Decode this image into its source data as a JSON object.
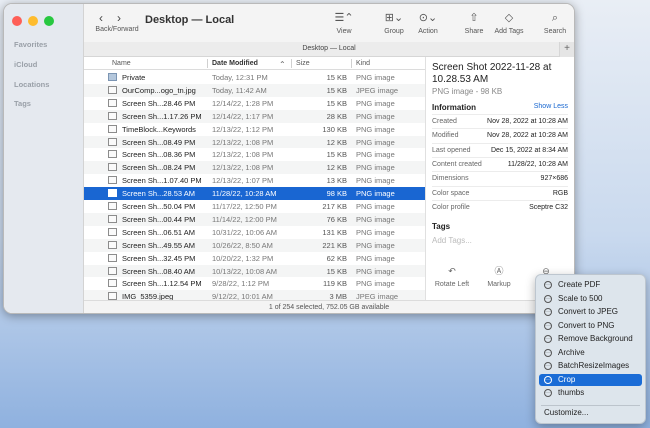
{
  "sidebar": {
    "sections": [
      "Favorites",
      "iCloud",
      "Locations",
      "Tags"
    ]
  },
  "toolbar": {
    "nav_label": "Back/Forward",
    "title": "Desktop — Local",
    "buttons": [
      {
        "name": "view",
        "label": "View",
        "icon": "list-icon"
      },
      {
        "name": "group",
        "label": "Group",
        "icon": "grid-icon"
      },
      {
        "name": "action",
        "label": "Action",
        "icon": "ellipsis-icon"
      },
      {
        "name": "share",
        "label": "Share",
        "icon": "share-icon"
      },
      {
        "name": "add-tags",
        "label": "Add Tags",
        "icon": "tag-icon"
      },
      {
        "name": "search",
        "label": "Search",
        "icon": "search-icon"
      }
    ]
  },
  "pathbar": {
    "title": "Desktop — Local"
  },
  "columns": [
    "Name",
    "Date Modified",
    "Size",
    "Kind"
  ],
  "files": [
    {
      "name": "Private",
      "date": "Today, 12:31 PM",
      "size": "15 KB",
      "kind": "PNG image",
      "type": "folder"
    },
    {
      "name": "OurComp...ogo_tn.jpg",
      "date": "Today, 11:42 AM",
      "size": "15 KB",
      "kind": "JPEG image",
      "type": "image"
    },
    {
      "name": "Screen Sh...28.46 PM",
      "date": "12/14/22, 1:28 PM",
      "size": "15 KB",
      "kind": "PNG image",
      "type": "file"
    },
    {
      "name": "Screen Sh...1.17.26 PM",
      "date": "12/14/22, 1:17 PM",
      "size": "28 KB",
      "kind": "PNG image",
      "type": "file"
    },
    {
      "name": "TimeBlock...Keywords",
      "date": "12/13/22, 1:12 PM",
      "size": "130 KB",
      "kind": "PNG image",
      "type": "file"
    },
    {
      "name": "Screen Sh...08.49 PM",
      "date": "12/13/22, 1:08 PM",
      "size": "12 KB",
      "kind": "PNG image",
      "type": "file"
    },
    {
      "name": "Screen Sh...08.36 PM",
      "date": "12/13/22, 1:08 PM",
      "size": "15 KB",
      "kind": "PNG image",
      "type": "file"
    },
    {
      "name": "Screen Sh...08.24 PM",
      "date": "12/13/22, 1:08 PM",
      "size": "12 KB",
      "kind": "PNG image",
      "type": "file"
    },
    {
      "name": "Screen Sh...1.07.40 PM",
      "date": "12/13/22, 1:07 PM",
      "size": "13 KB",
      "kind": "PNG image",
      "type": "file"
    },
    {
      "name": "Screen Sh...28.53 AM",
      "date": "11/28/22, 10:28 AM",
      "size": "98 KB",
      "kind": "PNG image",
      "type": "file",
      "selected": true
    },
    {
      "name": "Screen Sh...50.04 PM",
      "date": "11/17/22, 12:50 PM",
      "size": "217 KB",
      "kind": "PNG image",
      "type": "file"
    },
    {
      "name": "Screen Sh...00.44 PM",
      "date": "11/14/22, 12:00 PM",
      "size": "76 KB",
      "kind": "PNG image",
      "type": "file"
    },
    {
      "name": "Screen Sh...06.51 AM",
      "date": "10/31/22, 10:06 AM",
      "size": "131 KB",
      "kind": "PNG image",
      "type": "file"
    },
    {
      "name": "Screen Sh...49.55 AM",
      "date": "10/26/22, 8:50 AM",
      "size": "221 KB",
      "kind": "PNG image",
      "type": "file"
    },
    {
      "name": "Screen Sh...32.45 PM",
      "date": "10/20/22, 1:32 PM",
      "size": "62 KB",
      "kind": "PNG image",
      "type": "file"
    },
    {
      "name": "Screen Sh...08.40 AM",
      "date": "10/13/22, 10:08 AM",
      "size": "15 KB",
      "kind": "PNG image",
      "type": "file"
    },
    {
      "name": "Screen Sh...1.12.54 PM",
      "date": "9/28/22, 1:12 PM",
      "size": "119 KB",
      "kind": "PNG image",
      "type": "file"
    },
    {
      "name": "IMG_5359.jpeg",
      "date": "9/12/22, 10:01 AM",
      "size": "3 MB",
      "kind": "JPEG image",
      "type": "image"
    }
  ],
  "status": "1 of 254 selected, 752.05 GB available",
  "preview": {
    "title": "Screen Shot 2022-11-28 at 10.28.53 AM",
    "subtitle": "PNG image - 98 KB",
    "info_heading": "Information",
    "show_less": "Show Less",
    "info": [
      {
        "key": "Created",
        "value": "Nov 28, 2022 at 10:28 AM"
      },
      {
        "key": "Modified",
        "value": "Nov 28, 2022 at 10:28 AM"
      },
      {
        "key": "Last opened",
        "value": "Dec 15, 2022 at 8:34 AM"
      },
      {
        "key": "Content created",
        "value": "11/28/22, 10:28 AM"
      },
      {
        "key": "Dimensions",
        "value": "927×686"
      },
      {
        "key": "Color space",
        "value": "RGB"
      },
      {
        "key": "Color profile",
        "value": "Sceptre C32"
      }
    ],
    "tags_heading": "Tags",
    "tags_placeholder": "Add Tags...",
    "actions": [
      {
        "label": "Rotate Left",
        "icon": "rotate-left-icon"
      },
      {
        "label": "Markup",
        "icon": "markup-icon"
      },
      {
        "label": "",
        "icon": "more-icon"
      }
    ]
  },
  "menu": {
    "items": [
      {
        "label": "Create PDF",
        "icon": "pdf-icon"
      },
      {
        "label": "Scale to 500",
        "icon": "scale-icon"
      },
      {
        "label": "Convert to JPEG",
        "icon": "convert-icon"
      },
      {
        "label": "Convert to PNG",
        "icon": "convert-icon"
      },
      {
        "label": "Remove Background",
        "icon": "background-icon"
      },
      {
        "label": "Archive",
        "icon": "archive-icon"
      },
      {
        "label": "BatchResizeImages",
        "icon": "resize-icon"
      },
      {
        "label": "Crop",
        "icon": "crop-icon",
        "highlighted": true
      },
      {
        "label": "thumbs",
        "icon": "thumbs-icon"
      }
    ],
    "customize": "Customize..."
  },
  "colors": {
    "accent": "#1966d2",
    "close": "#fe5f57",
    "minimize": "#febc2e",
    "zoom": "#28c840"
  }
}
